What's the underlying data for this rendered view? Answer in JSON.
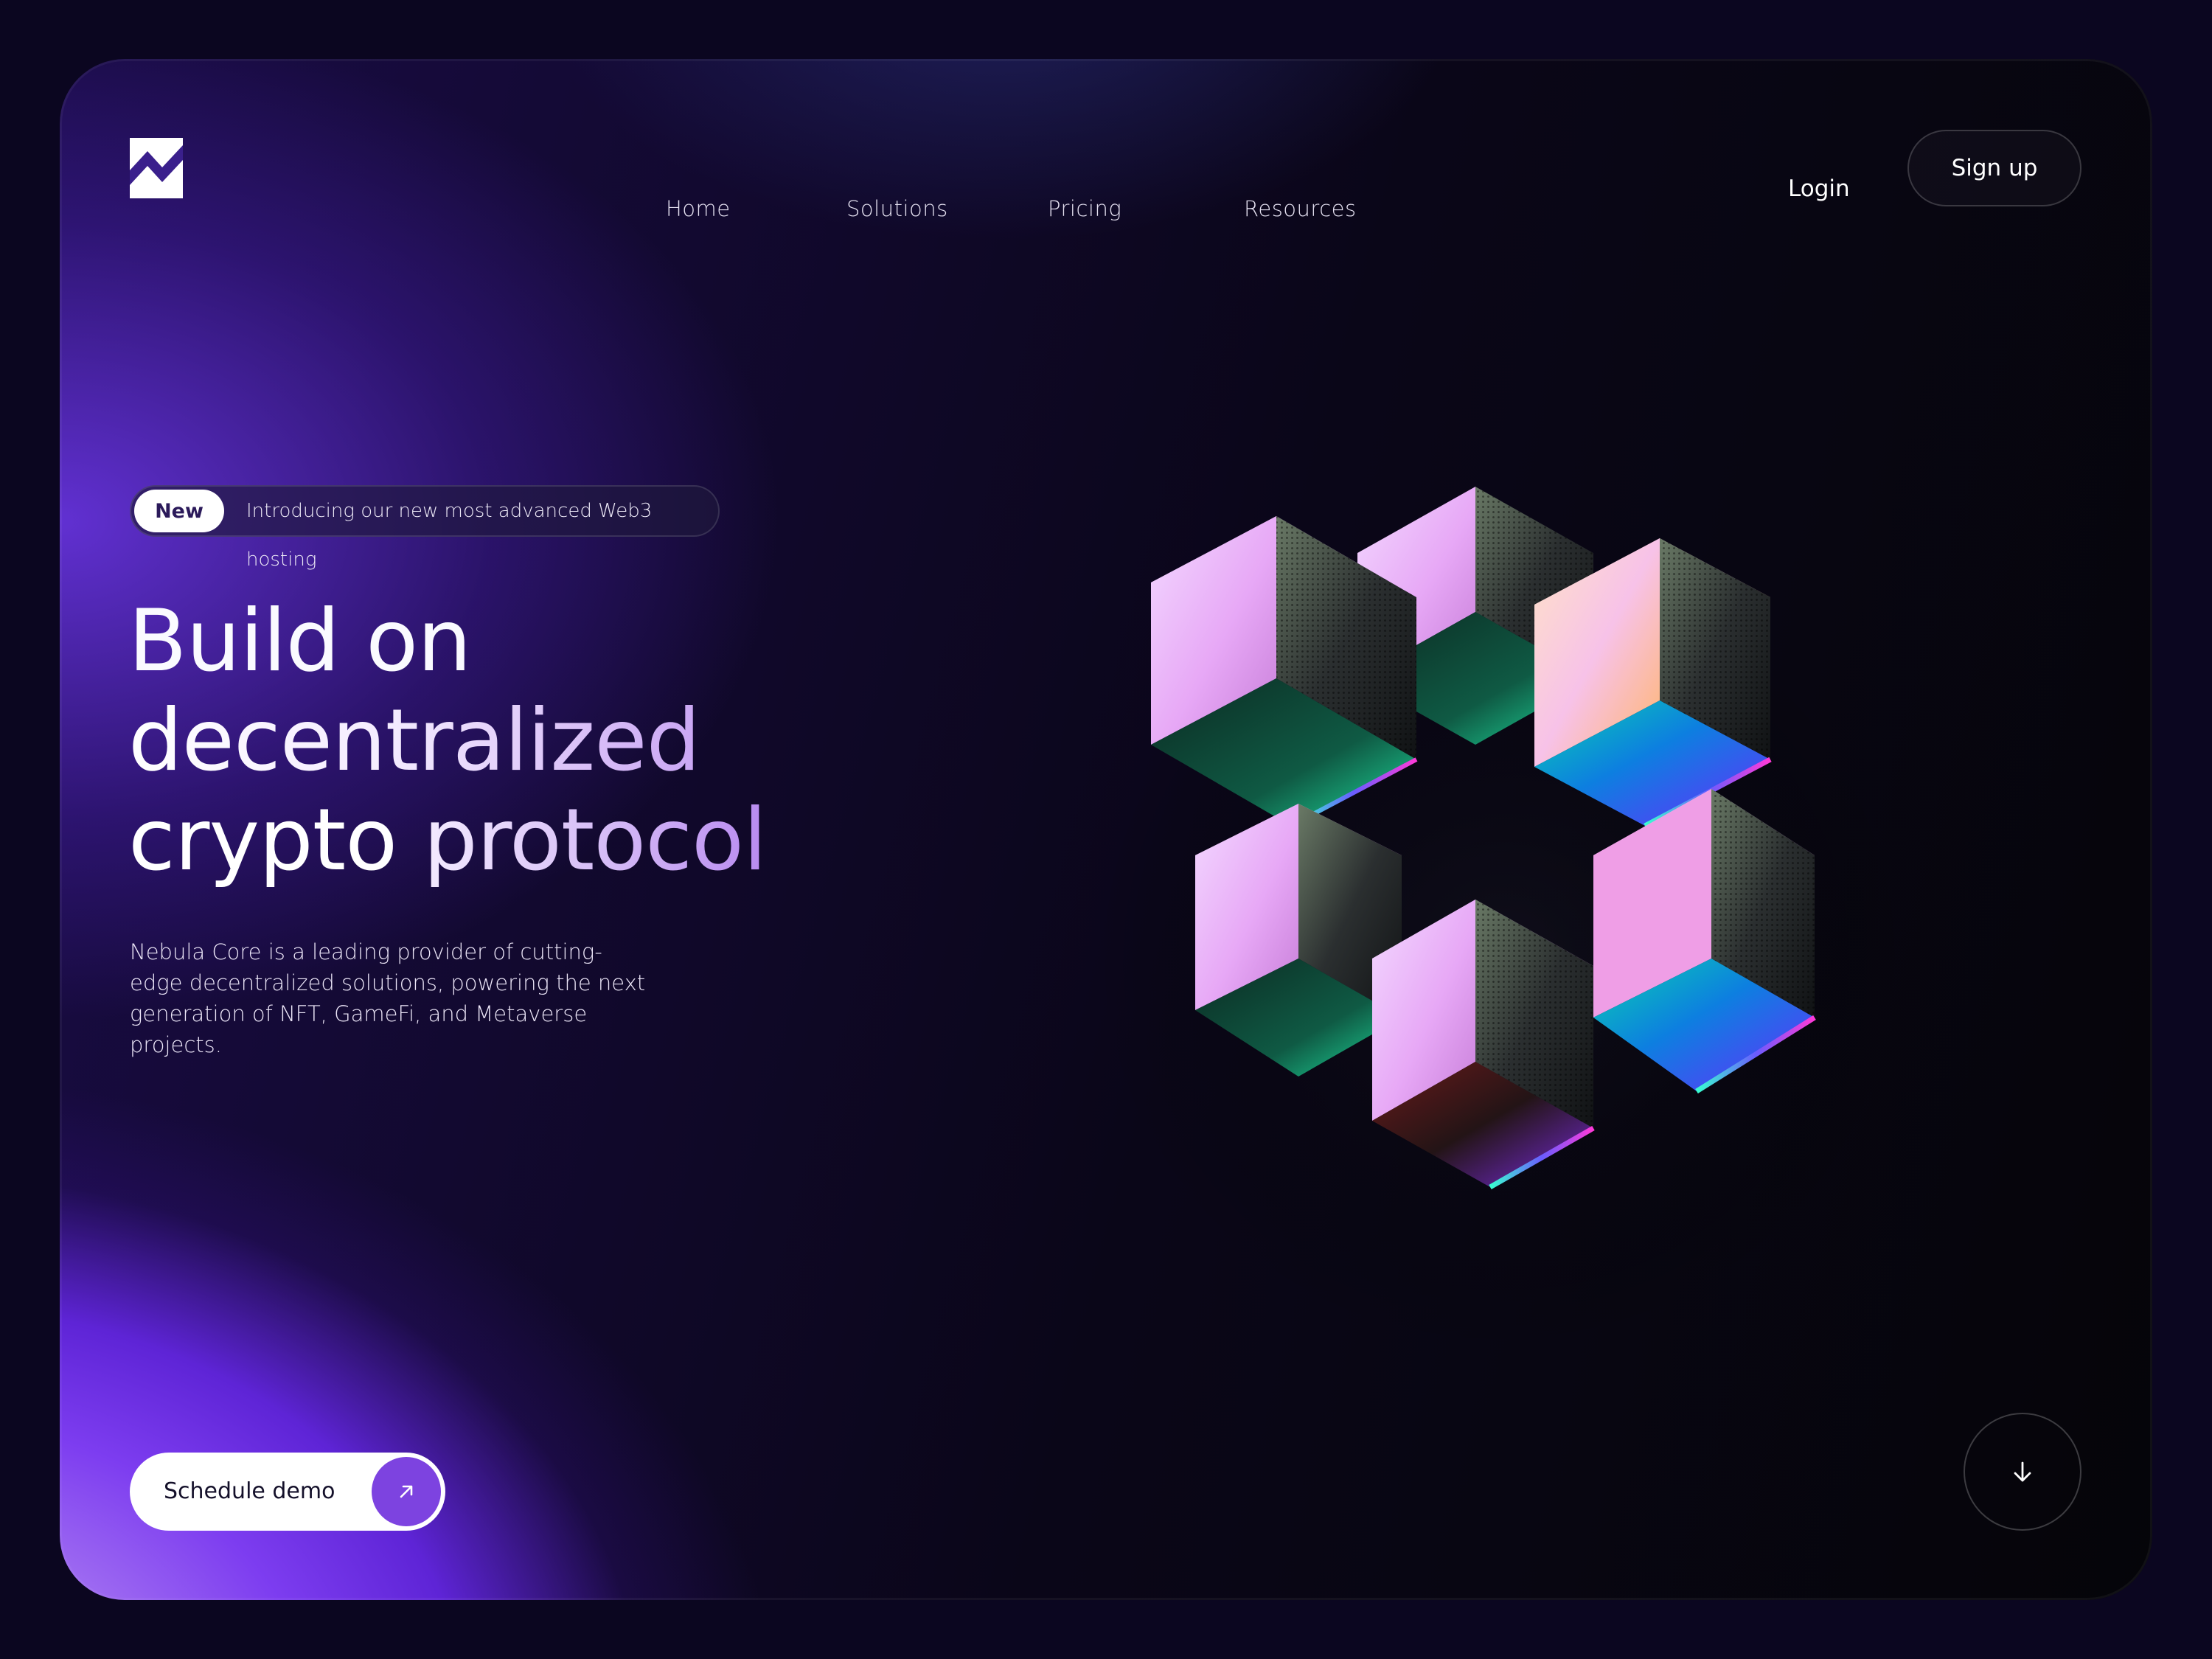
{
  "brand": {
    "logo_icon": "brand-logo-icon"
  },
  "nav": {
    "items": [
      {
        "label": "Home"
      },
      {
        "label": "Solutions"
      },
      {
        "label": "Pricing"
      },
      {
        "label": "Resources"
      }
    ],
    "login_label": "Login",
    "signup_label": "Sign up"
  },
  "hero": {
    "badge": {
      "tag": "New",
      "text": "Introducing our new most advanced Web3 hosting"
    },
    "headline": {
      "line1": "Build on",
      "line2": "decentralized",
      "line3_part1": "crypto",
      "line3_part2": "protocol"
    },
    "description": "Nebula Core is a leading provider of cutting-edge decentralized solutions, powering the next generation of NFT, GameFi, and Metaverse projects.",
    "cta": {
      "label": "Schedule demo",
      "icon": "arrow-up-right-icon"
    },
    "scroll_icon": "arrow-down-icon",
    "illustration": "iridescent-cubes-illustration"
  },
  "colors": {
    "background": "#0b0620",
    "accent": "#7d43e0",
    "purple_glow": "#7d3df0",
    "text": "#ffffff"
  }
}
